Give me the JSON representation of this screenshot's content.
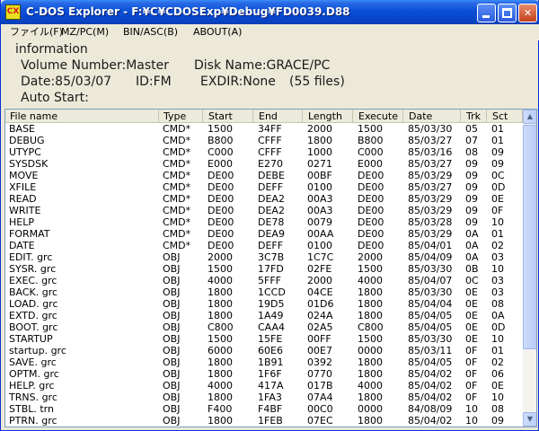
{
  "window": {
    "title": "C-DOS Explorer - F:¥C¥CDOSExp¥Debug¥FD0039.D88",
    "icon_text": "CX"
  },
  "menu": [
    "ファイル(F)",
    "MZ/PC(M)",
    "BIN/ASC(B)",
    "ABOUT(A)"
  ],
  "info": {
    "heading": "information",
    "volume": "Volume Number:Master",
    "disk_name": "Disk Name:GRACE/PC",
    "date": "Date:85/03/07",
    "id": "ID:FM",
    "exdir": "EXDIR:None",
    "files": "(55 files)",
    "auto_start": "Auto Start:"
  },
  "columns": [
    "File name",
    "Type",
    "Start",
    "End",
    "Length",
    "Execute",
    "Date",
    "Trk",
    "Sct"
  ],
  "rows": [
    [
      "BASE",
      "CMD*",
      "1500",
      "34FF",
      "2000",
      "1500",
      "85/03/30",
      "05",
      "01"
    ],
    [
      "DEBUG",
      "CMD*",
      "B800",
      "CFFF",
      "1800",
      "B800",
      "85/03/27",
      "07",
      "01"
    ],
    [
      "UTYPC",
      "CMD*",
      "C000",
      "CFFF",
      "1000",
      "C000",
      "85/03/16",
      "08",
      "09"
    ],
    [
      "SYSDSK",
      "CMD*",
      "E000",
      "E270",
      "0271",
      "E000",
      "85/03/27",
      "09",
      "09"
    ],
    [
      "MOVE",
      "CMD*",
      "DE00",
      "DEBE",
      "00BF",
      "DE00",
      "85/03/29",
      "09",
      "0C"
    ],
    [
      "XFILE",
      "CMD*",
      "DE00",
      "DEFF",
      "0100",
      "DE00",
      "85/03/27",
      "09",
      "0D"
    ],
    [
      "READ",
      "CMD*",
      "DE00",
      "DEA2",
      "00A3",
      "DE00",
      "85/03/29",
      "09",
      "0E"
    ],
    [
      "WRITE",
      "CMD*",
      "DE00",
      "DEA2",
      "00A3",
      "DE00",
      "85/03/29",
      "09",
      "0F"
    ],
    [
      "HELP",
      "CMD*",
      "DE00",
      "DE78",
      "0079",
      "DE00",
      "85/03/28",
      "09",
      "10"
    ],
    [
      "FORMAT",
      "CMD*",
      "DE00",
      "DEA9",
      "00AA",
      "DE00",
      "85/03/29",
      "0A",
      "01"
    ],
    [
      "DATE",
      "CMD*",
      "DE00",
      "DEFF",
      "0100",
      "DE00",
      "85/04/01",
      "0A",
      "02"
    ],
    [
      "EDIT. grc",
      "OBJ",
      "2000",
      "3C7B",
      "1C7C",
      "2000",
      "85/04/09",
      "0A",
      "03"
    ],
    [
      "SYSR. grc",
      "OBJ",
      "1500",
      "17FD",
      "02FE",
      "1500",
      "85/03/30",
      "0B",
      "10"
    ],
    [
      "EXEC. grc",
      "OBJ",
      "4000",
      "5FFF",
      "2000",
      "4000",
      "85/04/07",
      "0C",
      "03"
    ],
    [
      "BACK. grc",
      "OBJ",
      "1800",
      "1CCD",
      "04CE",
      "1800",
      "85/03/30",
      "0E",
      "03"
    ],
    [
      "LOAD. grc",
      "OBJ",
      "1800",
      "19D5",
      "01D6",
      "1800",
      "85/04/04",
      "0E",
      "08"
    ],
    [
      "EXTD. grc",
      "OBJ",
      "1800",
      "1A49",
      "024A",
      "1800",
      "85/04/05",
      "0E",
      "0A"
    ],
    [
      "BOOT. grc",
      "OBJ",
      "C800",
      "CAA4",
      "02A5",
      "C800",
      "85/04/05",
      "0E",
      "0D"
    ],
    [
      "STARTUP",
      "OBJ",
      "1500",
      "15FE",
      "00FF",
      "1500",
      "85/03/30",
      "0E",
      "10"
    ],
    [
      "startup. grc",
      "OBJ",
      "6000",
      "60E6",
      "00E7",
      "0000",
      "85/03/11",
      "0F",
      "01"
    ],
    [
      "SAVE. grc",
      "OBJ",
      "1800",
      "1B91",
      "0392",
      "1800",
      "85/04/05",
      "0F",
      "02"
    ],
    [
      "OPTM. grc",
      "OBJ",
      "1800",
      "1F6F",
      "0770",
      "1800",
      "85/04/02",
      "0F",
      "06"
    ],
    [
      "HELP. grc",
      "OBJ",
      "4000",
      "417A",
      "017B",
      "4000",
      "85/04/02",
      "0F",
      "0E"
    ],
    [
      "TRNS. grc",
      "OBJ",
      "1800",
      "1FA3",
      "07A4",
      "1800",
      "85/04/02",
      "0F",
      "10"
    ],
    [
      "STBL. trn",
      "OBJ",
      "F400",
      "F4BF",
      "00C0",
      "0000",
      "84/08/09",
      "10",
      "08"
    ],
    [
      "PTRN. grc",
      "OBJ",
      "1800",
      "1FEB",
      "07EC",
      "1800",
      "85/04/02",
      "10",
      "09"
    ]
  ]
}
